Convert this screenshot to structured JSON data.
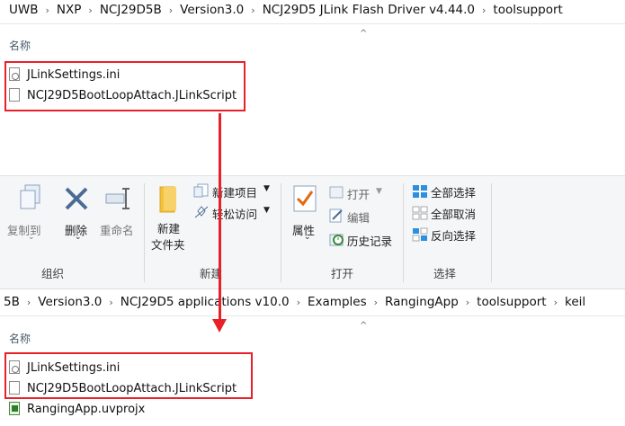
{
  "top_pane": {
    "breadcrumb": [
      "UWB",
      "NXP",
      "NCJ29D5B",
      "Version3.0",
      "NCJ29D5 JLink Flash Driver v4.44.0",
      "toolsupport"
    ],
    "column_name": "名称",
    "files": [
      {
        "name": "JLinkSettings.ini",
        "icon": "ini-file-icon"
      },
      {
        "name": "NCJ29D5BootLoopAttach.JLinkScript",
        "icon": "script-file-icon"
      }
    ]
  },
  "ribbon": {
    "copy_to": "复制到",
    "delete": "删除",
    "rename": "重命名",
    "new_folder_line1": "新建",
    "new_folder_line2": "文件夹",
    "new_item": "新建项目",
    "easy_access": "轻松访问",
    "properties": "属性",
    "open": "打开",
    "edit": "编辑",
    "history": "历史记录",
    "select_all": "全部选择",
    "select_none": "全部取消",
    "invert_selection": "反向选择",
    "group_organize": "组织",
    "group_new": "新建",
    "group_open": "打开",
    "group_select": "选择"
  },
  "bottom_pane": {
    "breadcrumb": [
      "5B",
      "Version3.0",
      "NCJ29D5 applications v10.0",
      "Examples",
      "RangingApp",
      "toolsupport",
      "keil"
    ],
    "column_name": "名称",
    "files": [
      {
        "name": "JLinkSettings.ini",
        "icon": "ini-file-icon"
      },
      {
        "name": "NCJ29D5BootLoopAttach.JLinkScript",
        "icon": "script-file-icon"
      },
      {
        "name": "RangingApp.uvprojx",
        "icon": "uvprojx-file-icon"
      }
    ]
  },
  "colors": {
    "annotation_red": "#e8202a",
    "accent_blue": "#1e6fd0"
  }
}
